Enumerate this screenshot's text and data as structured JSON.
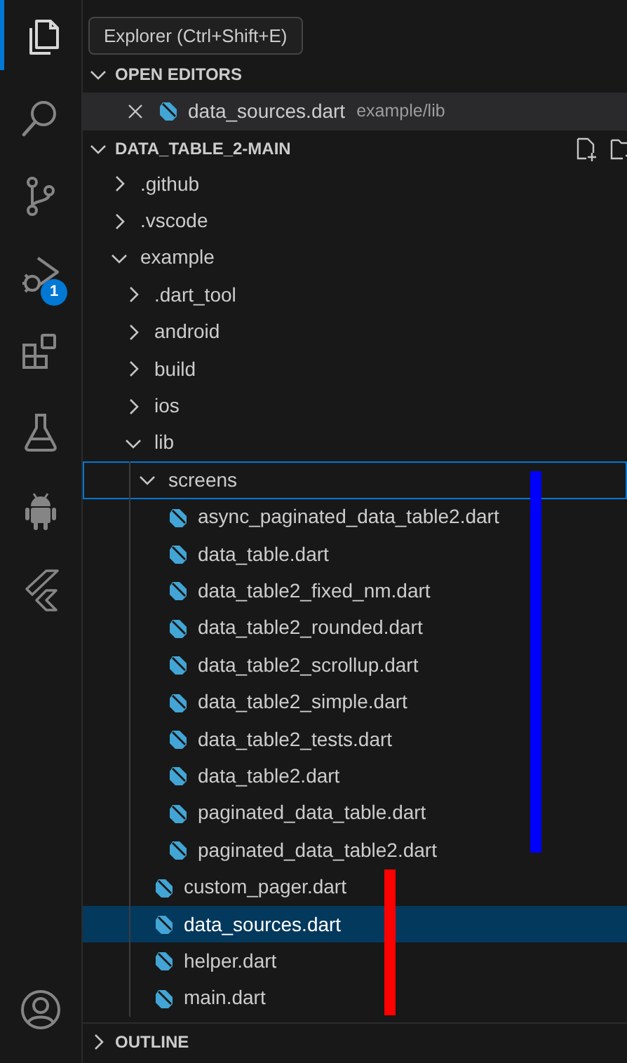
{
  "activity_bar": {
    "items": [
      {
        "kind": "explorer",
        "selected": true
      },
      {
        "kind": "search",
        "selected": false
      },
      {
        "kind": "source-control",
        "selected": false
      },
      {
        "kind": "run-debug",
        "selected": false,
        "badge": "1"
      },
      {
        "kind": "extensions",
        "selected": false
      },
      {
        "kind": "testing",
        "selected": false
      },
      {
        "kind": "android",
        "selected": false
      },
      {
        "kind": "flutter",
        "selected": false
      },
      {
        "kind": "account",
        "selected": false
      }
    ]
  },
  "tooltip": {
    "text": "Explorer (Ctrl+Shift+E)"
  },
  "open_editors": {
    "title": "OPEN EDITORS",
    "expanded": true,
    "items": [
      {
        "name": "data_sources.dart",
        "path": "example/lib"
      }
    ]
  },
  "explorer": {
    "title": "DATA_TABLE_2-MAIN",
    "expanded": true,
    "tree": [
      {
        "name": ".github",
        "kind": "folder",
        "expanded": false,
        "selected": false,
        "focused": false
      },
      {
        "name": ".vscode",
        "kind": "folder",
        "expanded": false,
        "selected": false,
        "focused": false
      },
      {
        "name": "example",
        "kind": "folder",
        "expanded": true,
        "selected": false,
        "focused": false,
        "children": [
          {
            "name": ".dart_tool",
            "kind": "folder",
            "expanded": false,
            "selected": false,
            "focused": false
          },
          {
            "name": "android",
            "kind": "folder",
            "expanded": false,
            "selected": false,
            "focused": false
          },
          {
            "name": "build",
            "kind": "folder",
            "expanded": false,
            "selected": false,
            "focused": false
          },
          {
            "name": "ios",
            "kind": "folder",
            "expanded": false,
            "selected": false,
            "focused": false
          },
          {
            "name": "lib",
            "kind": "folder",
            "expanded": true,
            "selected": false,
            "focused": false,
            "children": [
              {
                "name": "screens",
                "kind": "folder",
                "expanded": true,
                "selected": false,
                "focused": true,
                "children": [
                  {
                    "name": "async_paginated_data_table2.dart",
                    "kind": "file",
                    "selected": false,
                    "focused": false
                  },
                  {
                    "name": "data_table.dart",
                    "kind": "file",
                    "selected": false,
                    "focused": false
                  },
                  {
                    "name": "data_table2_fixed_nm.dart",
                    "kind": "file",
                    "selected": false,
                    "focused": false
                  },
                  {
                    "name": "data_table2_rounded.dart",
                    "kind": "file",
                    "selected": false,
                    "focused": false
                  },
                  {
                    "name": "data_table2_scrollup.dart",
                    "kind": "file",
                    "selected": false,
                    "focused": false
                  },
                  {
                    "name": "data_table2_simple.dart",
                    "kind": "file",
                    "selected": false,
                    "focused": false
                  },
                  {
                    "name": "data_table2_tests.dart",
                    "kind": "file",
                    "selected": false,
                    "focused": false
                  },
                  {
                    "name": "data_table2.dart",
                    "kind": "file",
                    "selected": false,
                    "focused": false
                  },
                  {
                    "name": "paginated_data_table.dart",
                    "kind": "file",
                    "selected": false,
                    "focused": false
                  },
                  {
                    "name": "paginated_data_table2.dart",
                    "kind": "file",
                    "selected": false,
                    "focused": false
                  }
                ]
              },
              {
                "name": "custom_pager.dart",
                "kind": "file",
                "selected": false,
                "focused": false
              },
              {
                "name": "data_sources.dart",
                "kind": "file",
                "selected": true,
                "focused": false
              },
              {
                "name": "helper.dart",
                "kind": "file",
                "selected": false,
                "focused": false
              },
              {
                "name": "main.dart",
                "kind": "file",
                "selected": false,
                "focused": false
              }
            ]
          }
        ]
      }
    ]
  },
  "outline": {
    "title": "OUTLINE",
    "expanded": false
  },
  "annotations": [
    {
      "color": "#0000ff"
    },
    {
      "color": "#ff0000"
    }
  ]
}
